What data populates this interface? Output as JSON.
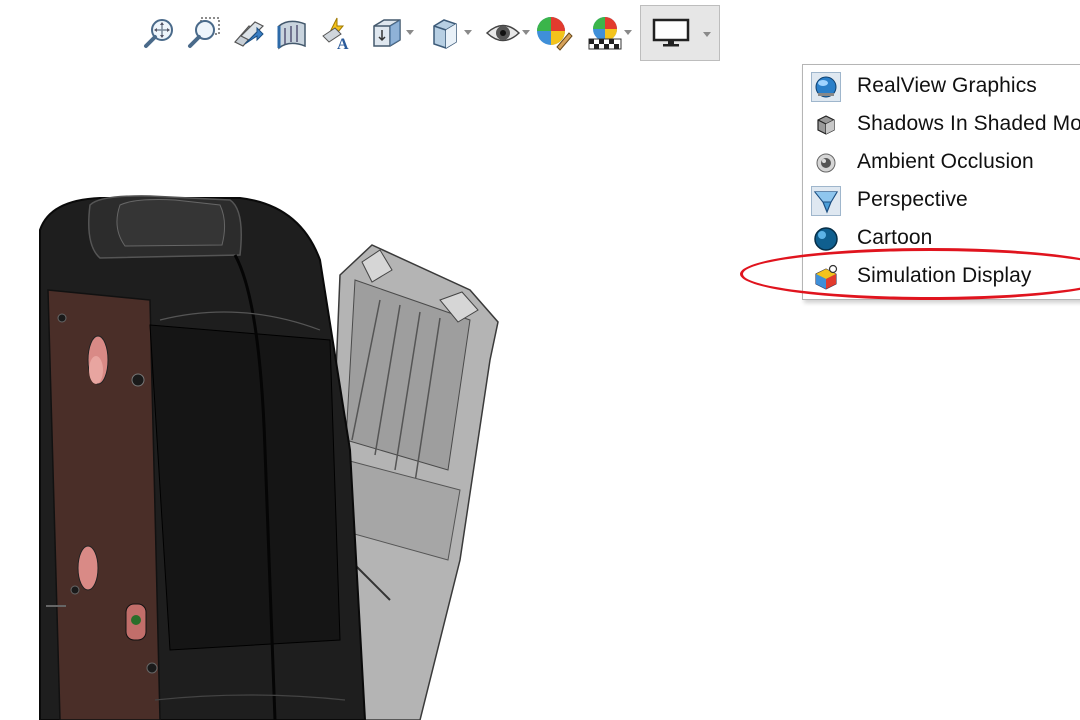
{
  "toolbar": {
    "buttons": [
      {
        "name": "zoom-to-fit-button",
        "icon": "zoom-to-fit-icon",
        "caret": false
      },
      {
        "name": "zoom-to-area-button",
        "icon": "zoom-to-area-icon",
        "caret": false
      },
      {
        "name": "previous-view-button",
        "icon": "previous-view-icon",
        "caret": false
      },
      {
        "name": "section-view-button",
        "icon": "section-view-icon",
        "caret": false
      },
      {
        "name": "dynamic-annotation-button",
        "icon": "dynamic-annotation-icon",
        "caret": false
      },
      {
        "name": "view-orientation-button",
        "icon": "view-orientation-icon",
        "caret": true
      },
      {
        "name": "display-style-button",
        "icon": "display-style-icon",
        "caret": true
      },
      {
        "name": "hide-show-items-button",
        "icon": "eye-icon",
        "caret": true
      },
      {
        "name": "edit-appearance-button",
        "icon": "appearance-icon",
        "caret": false
      },
      {
        "name": "apply-scene-button",
        "icon": "scene-icon",
        "caret": true
      },
      {
        "name": "view-settings-button",
        "icon": "monitor-icon",
        "caret": true,
        "active": true
      }
    ]
  },
  "menu": {
    "items": [
      {
        "label": "RealView Graphics",
        "icon": "realview-globe-icon",
        "checked": true
      },
      {
        "label": "Shadows In Shaded Mo",
        "icon": "shadow-cube-icon",
        "checked": false
      },
      {
        "label": "Ambient Occlusion",
        "icon": "ambient-occlusion-icon",
        "checked": false
      },
      {
        "label": "Perspective",
        "icon": "perspective-icon",
        "checked": true
      },
      {
        "label": "Cartoon",
        "icon": "cartoon-sphere-icon",
        "checked": false
      },
      {
        "label": "Simulation Display",
        "icon": "simulation-display-icon",
        "checked": false,
        "highlighted": true
      }
    ]
  },
  "colors": {
    "highlight": "#e0141e",
    "menu_border": "#b5b5b5",
    "checked_bg": "#dfe8f1"
  }
}
